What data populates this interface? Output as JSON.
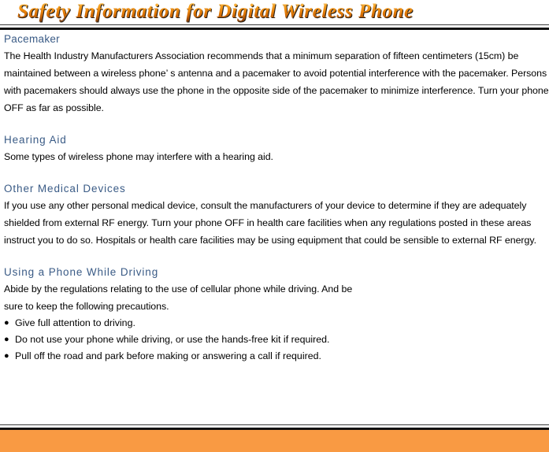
{
  "document": {
    "title": "Safety Information for Digital Wireless Phone",
    "title_gradient_top": "#fbd27a",
    "title_gradient_mid": "#e8820a",
    "title_gradient_bottom": "#6e3405",
    "heading_color": "#3a5b86",
    "body_color": "#000000",
    "footer_band_color": "#f99a43",
    "rule_color": "#111111"
  },
  "sections": [
    {
      "heading": "Pacemaker",
      "paragraphs": [
        "The Health Industry Manufacturers Association recommends that a minimum separation of fifteen centimeters (15cm) be maintained between a wireless phone’ s antenna and a pacemaker to avoid potential interference with the pacemaker. Persons with pacemakers should always use the phone in the opposite side of the pacemaker to minimize interference. Turn your phone OFF as far as possible."
      ]
    },
    {
      "heading": "Hearing Aid",
      "paragraphs": [
        "Some types of wireless phone may interfere with a hearing aid."
      ]
    },
    {
      "heading": "Other Medical Devices",
      "paragraphs": [
        "If you use any other personal medical device, consult the manufacturers of your device to determine if they are adequately shielded from external RF energy. Turn your phone OFF in health care facilities when any regulations posted in these areas instruct you to do so. Hospitals or health care facilities may be using equipment that could be sensible to external RF energy."
      ]
    },
    {
      "heading": "Using a Phone While Driving",
      "paragraphs": [
        "Abide by the regulations relating to the use of cellular phone while driving. And be",
        "sure to keep the following precautions."
      ],
      "bullets": [
        "Give full attention to driving.",
        "Do not use your phone while driving, or use the hands-free kit if required.",
        "Pull off the road and park before making or answering a call if required."
      ],
      "bullet_glyph": "●"
    }
  ]
}
